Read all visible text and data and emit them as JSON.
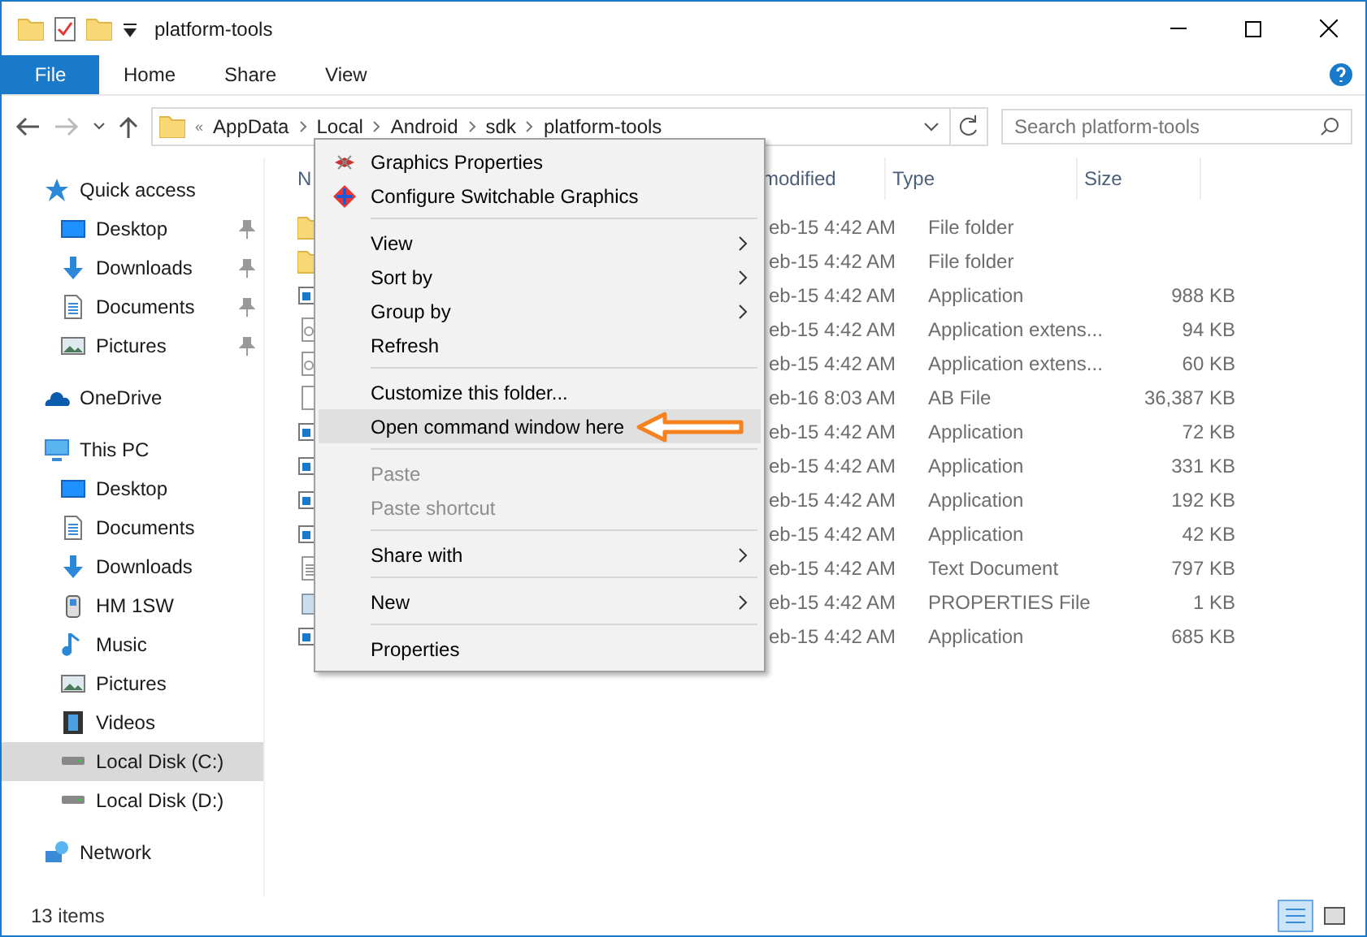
{
  "window": {
    "title": "platform-tools"
  },
  "ribbon_tabs": [
    {
      "label": "File",
      "selected": true
    },
    {
      "label": "Home",
      "selected": false
    },
    {
      "label": "Share",
      "selected": false
    },
    {
      "label": "View",
      "selected": false
    }
  ],
  "address": {
    "overflow": "«",
    "path": [
      "AppData",
      "Local",
      "Android",
      "sdk",
      "platform-tools"
    ]
  },
  "search": {
    "placeholder": "Search platform-tools"
  },
  "sidebar": {
    "items": [
      {
        "label": "Quick access",
        "kind": "star",
        "pinned": false,
        "selected": false,
        "children": [
          {
            "label": "Desktop",
            "kind": "desktop",
            "pinned": true,
            "selected": false
          },
          {
            "label": "Downloads",
            "kind": "download",
            "pinned": true,
            "selected": false
          },
          {
            "label": "Documents",
            "kind": "document",
            "pinned": true,
            "selected": false
          },
          {
            "label": "Pictures",
            "kind": "picture",
            "pinned": true,
            "selected": false
          }
        ]
      },
      {
        "label": "OneDrive",
        "kind": "cloud",
        "pinned": false,
        "selected": false
      },
      {
        "label": "This PC",
        "kind": "pc",
        "pinned": false,
        "selected": false,
        "children": [
          {
            "label": "Desktop",
            "kind": "desktop",
            "pinned": false,
            "selected": false
          },
          {
            "label": "Documents",
            "kind": "document",
            "pinned": false,
            "selected": false
          },
          {
            "label": "Downloads",
            "kind": "download",
            "pinned": false,
            "selected": false
          },
          {
            "label": "HM 1SW",
            "kind": "device",
            "pinned": false,
            "selected": false
          },
          {
            "label": "Music",
            "kind": "music",
            "pinned": false,
            "selected": false
          },
          {
            "label": "Pictures",
            "kind": "picture",
            "pinned": false,
            "selected": false
          },
          {
            "label": "Videos",
            "kind": "video",
            "pinned": false,
            "selected": false
          },
          {
            "label": "Local Disk (C:)",
            "kind": "drive",
            "pinned": false,
            "selected": true
          },
          {
            "label": "Local Disk (D:)",
            "kind": "drive",
            "pinned": false,
            "selected": false
          }
        ]
      },
      {
        "label": "Network",
        "kind": "network",
        "pinned": false,
        "selected": false
      }
    ]
  },
  "file_list": {
    "columns": [
      "N",
      "modified",
      "Type",
      "Size"
    ],
    "rows": [
      {
        "kind": "folder",
        "modified": "eb-15 4:42 AM",
        "type": "File folder",
        "size": ""
      },
      {
        "kind": "folder",
        "modified": "eb-15 4:42 AM",
        "type": "File folder",
        "size": ""
      },
      {
        "kind": "app",
        "modified": "eb-15 4:42 AM",
        "type": "Application",
        "size": "988 KB"
      },
      {
        "kind": "dll",
        "modified": "eb-15 4:42 AM",
        "type": "Application extens...",
        "size": "94 KB"
      },
      {
        "kind": "dll",
        "modified": "eb-15 4:42 AM",
        "type": "Application extens...",
        "size": "60 KB"
      },
      {
        "kind": "file",
        "modified": "eb-16 8:03 AM",
        "type": "AB File",
        "size": "36,387 KB"
      },
      {
        "kind": "app",
        "modified": "eb-15 4:42 AM",
        "type": "Application",
        "size": "72 KB"
      },
      {
        "kind": "app",
        "modified": "eb-15 4:42 AM",
        "type": "Application",
        "size": "331 KB"
      },
      {
        "kind": "app",
        "modified": "eb-15 4:42 AM",
        "type": "Application",
        "size": "192 KB"
      },
      {
        "kind": "app",
        "modified": "eb-15 4:42 AM",
        "type": "Application",
        "size": "42 KB"
      },
      {
        "kind": "text",
        "modified": "eb-15 4:42 AM",
        "type": "Text Document",
        "size": "797 KB"
      },
      {
        "kind": "properties",
        "modified": "eb-15 4:42 AM",
        "type": "PROPERTIES File",
        "size": "1 KB"
      },
      {
        "kind": "app",
        "modified": "eb-15 4:42 AM",
        "type": "Application",
        "size": "685 KB"
      }
    ]
  },
  "context_menu": {
    "groups": [
      [
        {
          "label": "Graphics Properties",
          "disabled": false,
          "submenu": false,
          "selected": false
        },
        {
          "label": "Configure Switchable Graphics",
          "disabled": false,
          "submenu": false,
          "selected": false
        }
      ],
      [
        {
          "label": "View",
          "disabled": false,
          "submenu": true,
          "selected": false
        },
        {
          "label": "Sort by",
          "disabled": false,
          "submenu": true,
          "selected": false
        },
        {
          "label": "Group by",
          "disabled": false,
          "submenu": true,
          "selected": false
        },
        {
          "label": "Refresh",
          "disabled": false,
          "submenu": false,
          "selected": false
        }
      ],
      [
        {
          "label": "Customize this folder...",
          "disabled": false,
          "submenu": false,
          "selected": false
        },
        {
          "label": "Open command window here",
          "disabled": false,
          "submenu": false,
          "selected": true,
          "pointer": true
        }
      ],
      [
        {
          "label": "Paste",
          "disabled": true,
          "submenu": false,
          "selected": false
        },
        {
          "label": "Paste shortcut",
          "disabled": true,
          "submenu": false,
          "selected": false
        }
      ],
      [
        {
          "label": "Share with",
          "disabled": false,
          "submenu": true,
          "selected": false
        }
      ],
      [
        {
          "label": "New",
          "disabled": false,
          "submenu": true,
          "selected": false
        }
      ],
      [
        {
          "label": "Properties",
          "disabled": false,
          "submenu": false,
          "selected": false
        }
      ]
    ]
  },
  "status_bar": {
    "count": "13 items"
  }
}
